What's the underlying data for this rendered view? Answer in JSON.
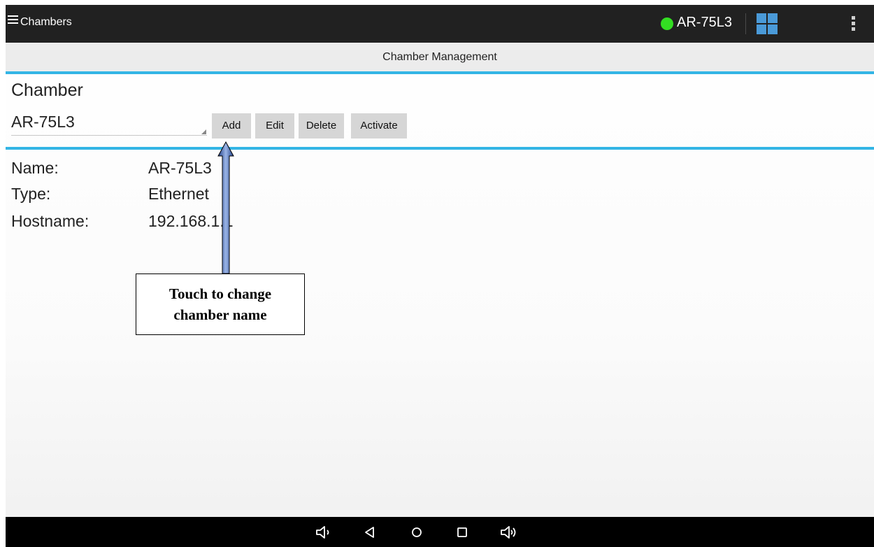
{
  "actionbar": {
    "title": "Chambers",
    "active_chamber": "AR-75L3",
    "status_color": "#33dd22",
    "icons": [
      "menu-icon",
      "tile-grid-icon",
      "overflow-menu-icon"
    ]
  },
  "screen": {
    "title": "Chamber Management"
  },
  "chamber": {
    "section_label": "Chamber",
    "selected": "AR-75L3",
    "buttons": {
      "add": "Add",
      "edit": "Edit",
      "delete": "Delete",
      "activate": "Activate"
    }
  },
  "details": {
    "name_label": "Name:",
    "name_value": "AR-75L3",
    "type_label": "Type:",
    "type_value": "Ethernet",
    "hostname_label": "Hostname:",
    "hostname_value": "192.168.1.1"
  },
  "annotation": {
    "line1": "Touch to change",
    "line2": "chamber name"
  },
  "navbar": {
    "icons": [
      "volume-down-icon",
      "back-icon",
      "home-icon",
      "recents-icon",
      "volume-up-icon"
    ]
  },
  "colors": {
    "accent": "#33b5e5",
    "actionbar": "#212121",
    "navbar": "#000000"
  }
}
